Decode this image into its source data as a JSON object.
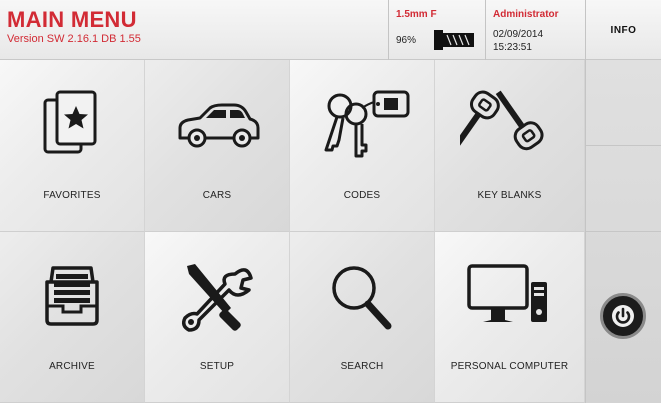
{
  "header": {
    "title": "MAIN MENU",
    "version": "Version SW 2.16.1 DB 1.55",
    "blank_type": "1.5mm F",
    "blank_percent": "96%",
    "user": "Administrator",
    "date": "02/09/2014",
    "time": "15:23:51",
    "info_label": "INFO"
  },
  "menu": {
    "favorites": "FAVORITES",
    "cars": "CARS",
    "codes": "CODES",
    "key_blanks": "KEY BLANKS",
    "archive": "ARCHIVE",
    "setup": "SETUP",
    "search": "SEARCH",
    "personal_computer": "PERSONAL COMPUTER"
  },
  "colors": {
    "accent": "#d22b35",
    "icon": "#1a1a1a"
  }
}
